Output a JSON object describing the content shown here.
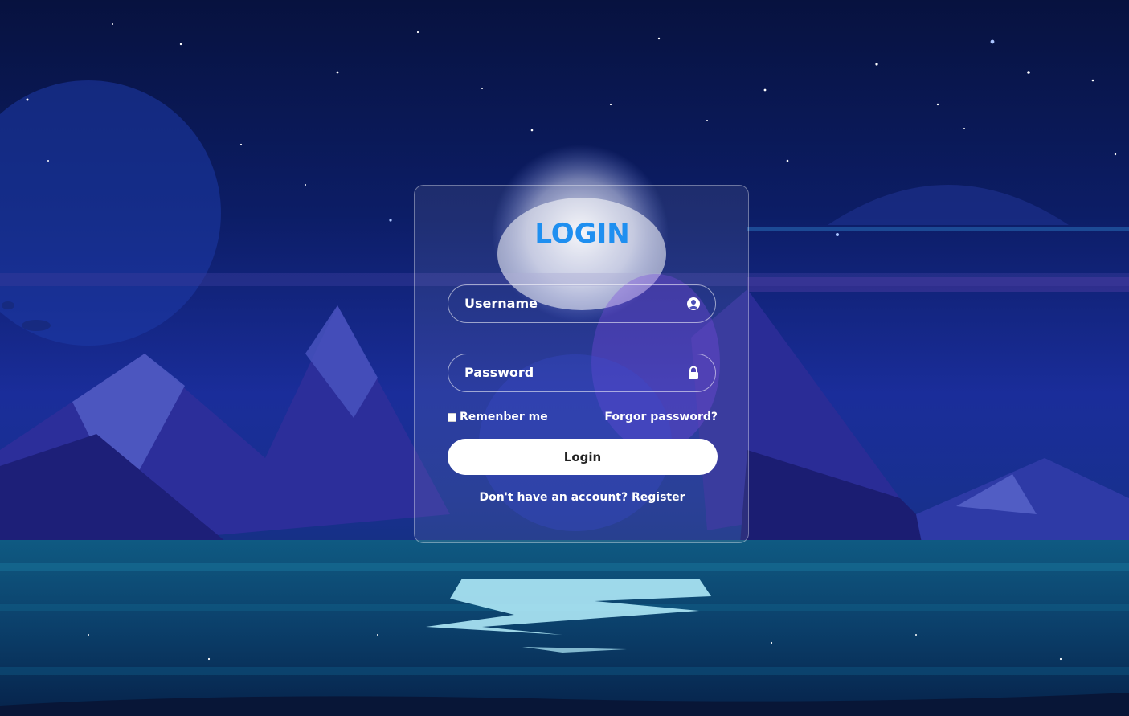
{
  "login": {
    "title": "LOGIN",
    "username_placeholder": "Username",
    "password_placeholder": "Password",
    "remember_label": "Remenber me",
    "forgot_label": "Forgor password?",
    "submit_label": "Login",
    "no_account_text": "Don't have an account?",
    "register_label": "Register"
  },
  "icons": {
    "username": "user-circle-icon",
    "password": "lock-icon"
  },
  "colors": {
    "title": "#1f8ff0",
    "button_bg": "#ffffff",
    "button_text": "#222222",
    "text": "#ffffff"
  }
}
